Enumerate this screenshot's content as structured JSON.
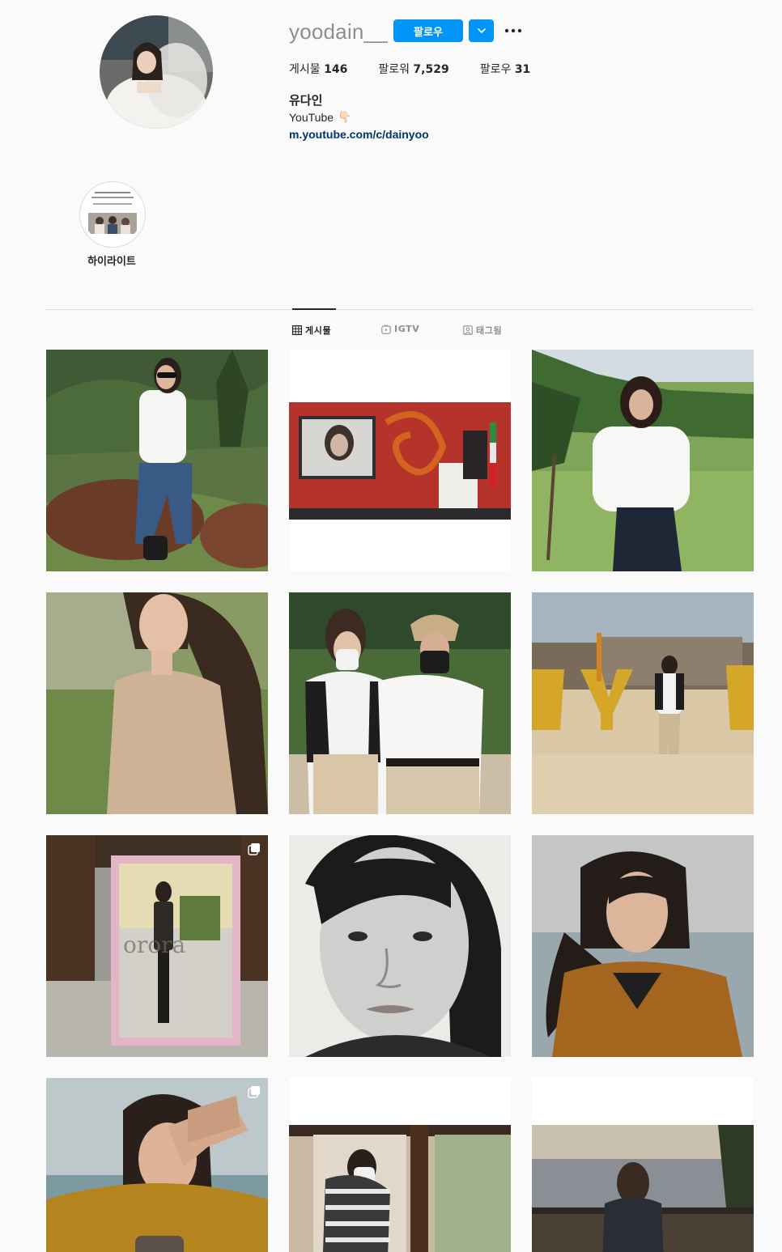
{
  "profile": {
    "username": "yoodain__",
    "follow_label": "팔로우",
    "full_name": "유다인",
    "bio": "YouTube",
    "bio_emoji": "👇🏻",
    "link": "m.youtube.com/c/dainyoo",
    "stats": [
      {
        "label": "게시물",
        "value": "146"
      },
      {
        "label": "팔로워",
        "value": "7,529"
      },
      {
        "label": "팔로우",
        "value": "31"
      }
    ]
  },
  "highlight": {
    "label": "하이라이트"
  },
  "tabs": [
    {
      "label": "게시물",
      "icon": "grid-icon",
      "active": true
    },
    {
      "label": "IGTV",
      "icon": "igtv-icon",
      "active": false
    },
    {
      "label": "태그됨",
      "icon": "tagged-icon",
      "active": false
    }
  ],
  "colors": {
    "accent": "#0095f6",
    "link": "#00376b",
    "background": "#fafafa"
  },
  "posts": [
    {
      "description": "woman in white shirt sitting on rock, green hills",
      "multi": false
    },
    {
      "description": "film festival stage with red backdrop and screen",
      "multi": false
    },
    {
      "description": "woman in white shirt on grassy hillside",
      "multi": false
    },
    {
      "description": "smiling woman with long wavy hair, beige top",
      "multi": false
    },
    {
      "description": "two people in masks and sunglasses outdoors",
      "multi": false
    },
    {
      "description": "person on beach with large yellow letters",
      "multi": false
    },
    {
      "description": "pink-framed mirror reflection outdoors",
      "multi": true
    },
    {
      "description": "black and white portrait",
      "multi": false
    },
    {
      "description": "woman in brown coat by the sea",
      "multi": false
    },
    {
      "description": "woman in mustard coat shading eyes",
      "multi": true
    },
    {
      "description": "person in striped shirt with mask by window",
      "multi": false
    },
    {
      "description": "woman overlooking city skyline",
      "multi": false
    }
  ]
}
